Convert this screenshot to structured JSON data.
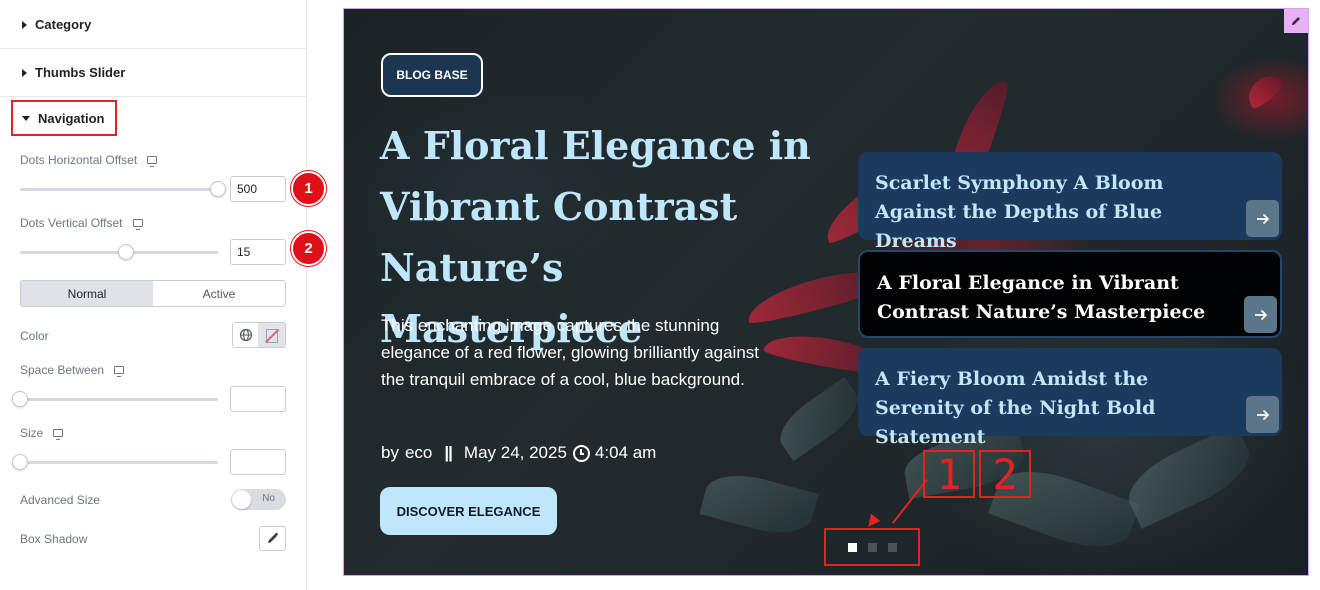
{
  "panel": {
    "sections": [
      {
        "label": "Category",
        "expanded": false
      },
      {
        "label": "Thumbs Slider",
        "expanded": false
      },
      {
        "label": "Navigation",
        "expanded": true
      }
    ],
    "controls": {
      "dots_horizontal_offset": {
        "label": "Dots Horizontal Offset",
        "value": "500",
        "badge": "1",
        "icon": "desktop-icon"
      },
      "dots_vertical_offset": {
        "label": "Dots Vertical Offset",
        "value": "15",
        "badge": "2",
        "icon": "desktop-icon"
      },
      "state_tabs": [
        "Normal",
        "Active"
      ],
      "active_tab": "Normal",
      "color": {
        "label": "Color"
      },
      "space_between": {
        "label": "Space Between",
        "value": ""
      },
      "size": {
        "label": "Size",
        "value": ""
      },
      "advanced_size": {
        "label": "Advanced Size",
        "toggle": "No"
      },
      "box_shadow": {
        "label": "Box Shadow"
      }
    }
  },
  "preview": {
    "badge": "BLOG BASE",
    "title": "A Floral Elegance in Vibrant Contrast Nature’s Masterpiece",
    "description": "This enchanting image captures the stunning elegance of a red flower, glowing brilliantly against the tranquil embrace of a cool, blue background.",
    "meta": {
      "by": "by",
      "author": "eco",
      "separator": "||",
      "date": "May 24, 2025",
      "time": "4:04 am"
    },
    "cta": "DISCOVER ELEGANCE",
    "thumbs": [
      {
        "title": "Scarlet Symphony A Bloom Against the Depths of Blue Dreams",
        "active": false
      },
      {
        "title": "A Floral Elegance in Vibrant Contrast Nature’s Masterpiece",
        "active": true
      },
      {
        "title": "A Fiery Bloom Amidst the Serenity of the Night Bold Statement",
        "active": false
      }
    ],
    "dots": {
      "count": 3,
      "active_index": 0
    },
    "annotations": [
      "1",
      "2"
    ]
  },
  "colors": {
    "accent_red": "#e02424",
    "title_blue": "#bfe6fb",
    "thumb_bg": "#1c3a5d",
    "border_purple": "#d0a3e8"
  }
}
